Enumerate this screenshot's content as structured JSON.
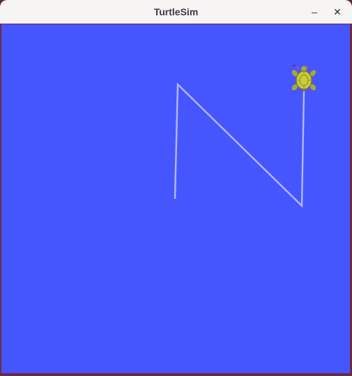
{
  "window": {
    "title": "TurtleSim",
    "minimize_icon": "–",
    "close_icon": "✕"
  },
  "canvas": {
    "background_color": "#4656fe",
    "pen_color": "#b3b8ff"
  },
  "turtle": {
    "icon": "turtle-icon",
    "shell_color": "#c9cc3a",
    "head_marker_color": "#d84a9a"
  }
}
